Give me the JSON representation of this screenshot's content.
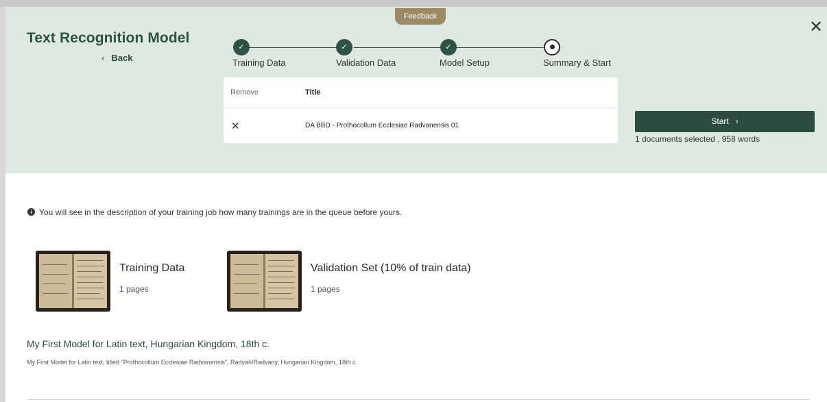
{
  "app": {
    "title": "Text Recognition Model",
    "back_label": "Back",
    "feedback_label": "Feedback",
    "close_icon": "close-icon"
  },
  "steps": [
    {
      "label": "Training Data",
      "state": "done"
    },
    {
      "label": "Validation Data",
      "state": "done"
    },
    {
      "label": "Model Setup",
      "state": "done"
    },
    {
      "label": "Summary & Start",
      "state": "current"
    }
  ],
  "table": {
    "headers": {
      "remove": "Remove",
      "title": "Title"
    },
    "rows": [
      {
        "title": "DA BBD - Prothocollum Ecclesiae Radvanensis 01"
      }
    ]
  },
  "start_button_label": "Start",
  "selection_summary": "1 documents selected , 958 words",
  "info_text": "You will see in the description of your training job how many trainings are in the queue before yours.",
  "sets": [
    {
      "title": "Training Data",
      "pages": "1 pages"
    },
    {
      "title": "Validation Set (10% of train data)",
      "pages": "1 pages"
    }
  ],
  "model": {
    "name": "My First Model for Latin text, Hungarian Kingdom, 18th c.",
    "description": "My First Model for Latin text, titled \"Prothocollum Ecclesiae Radvanensis\", Radvaň/Radvany, Hungarian Kingdom, 18th c."
  },
  "colors": {
    "header_bg": "#dde9e2",
    "accent": "#2f5246",
    "feedback": "#9d8a64"
  }
}
